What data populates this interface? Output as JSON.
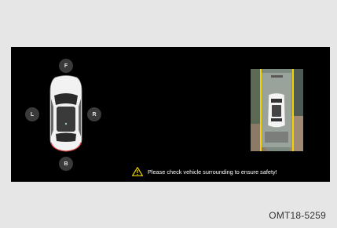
{
  "screen": {
    "direction_buttons": {
      "front": "F",
      "left": "L",
      "right": "R",
      "back": "B"
    },
    "warning_text": "Please check vehicle surrounding to ensure safety!",
    "warning_icon": "warning-triangle-icon",
    "accent_color": "#f2d400"
  },
  "figure_code": "OMT18-5259"
}
